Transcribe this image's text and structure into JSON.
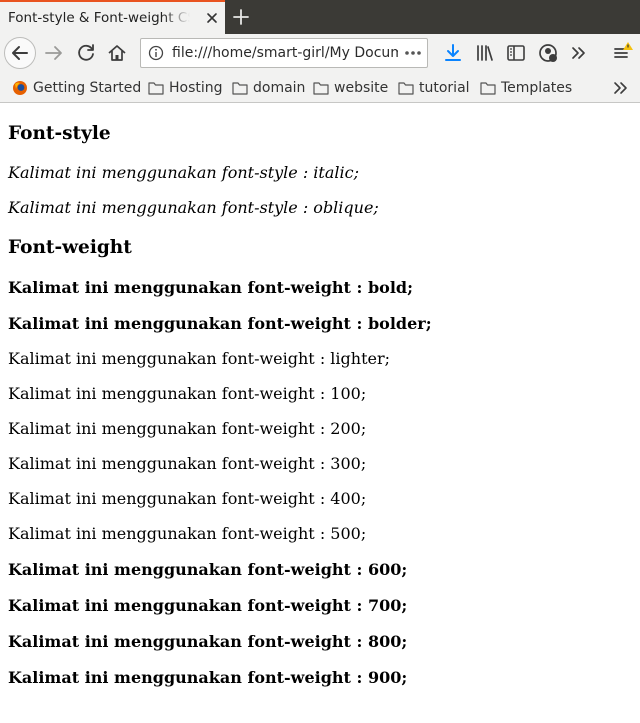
{
  "browser": {
    "tab_title": "Font-style & Font-weight CSS",
    "url": "file:///home/smart-girl/My Documents"
  },
  "bookmarks": [
    {
      "label": "Getting Started",
      "icon": "firefox-icon"
    },
    {
      "label": "Hosting",
      "icon": "folder-icon"
    },
    {
      "label": "domain",
      "icon": "folder-icon"
    },
    {
      "label": "website",
      "icon": "folder-icon"
    },
    {
      "label": "tutorial",
      "icon": "folder-icon"
    },
    {
      "label": "Templates",
      "icon": "folder-icon"
    }
  ],
  "content": {
    "heading_style": "Font-style",
    "style_lines": [
      "Kalimat ini menggunakan font-style : italic;",
      "Kalimat ini menggunakan font-style : oblique;"
    ],
    "heading_weight": "Font-weight",
    "weight_lines": [
      "Kalimat ini menggunakan font-weight : bold;",
      "Kalimat ini menggunakan font-weight : bolder;",
      "Kalimat ini menggunakan font-weight : lighter;",
      "Kalimat ini menggunakan font-weight : 100;",
      "Kalimat ini menggunakan font-weight : 200;",
      "Kalimat ini menggunakan font-weight : 300;",
      "Kalimat ini menggunakan font-weight : 400;",
      "Kalimat ini menggunakan font-weight : 500;",
      "Kalimat ini menggunakan font-weight : 600;",
      "Kalimat ini menggunakan font-weight : 700;",
      "Kalimat ini menggunakan font-weight : 800;",
      "Kalimat ini menggunakan font-weight : 900;"
    ]
  },
  "colors": {
    "tab_accent": "#e95420",
    "download_icon": "#0a84ff",
    "warning_badge": "#f5c211"
  }
}
